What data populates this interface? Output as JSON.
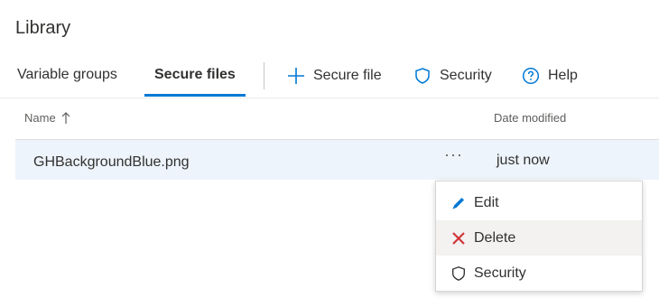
{
  "page": {
    "title": "Library"
  },
  "tabs": [
    {
      "label": "Variable groups"
    },
    {
      "label": "Secure files"
    }
  ],
  "commands": {
    "secure_file": "Secure file",
    "security": "Security",
    "help": "Help"
  },
  "table": {
    "columns": {
      "name": "Name",
      "date_modified": "Date modified"
    },
    "rows": [
      {
        "name": "GHBackgroundBlue.png",
        "more": "···",
        "date_modified": "just now"
      }
    ]
  },
  "context_menu": {
    "items": [
      {
        "label": "Edit",
        "icon": "pencil-icon"
      },
      {
        "label": "Delete",
        "icon": "x-icon"
      },
      {
        "label": "Security",
        "icon": "shield-icon"
      }
    ]
  },
  "colors": {
    "accent": "#0078d4",
    "delete": "#d13438",
    "row_selected": "#edf4fb"
  }
}
